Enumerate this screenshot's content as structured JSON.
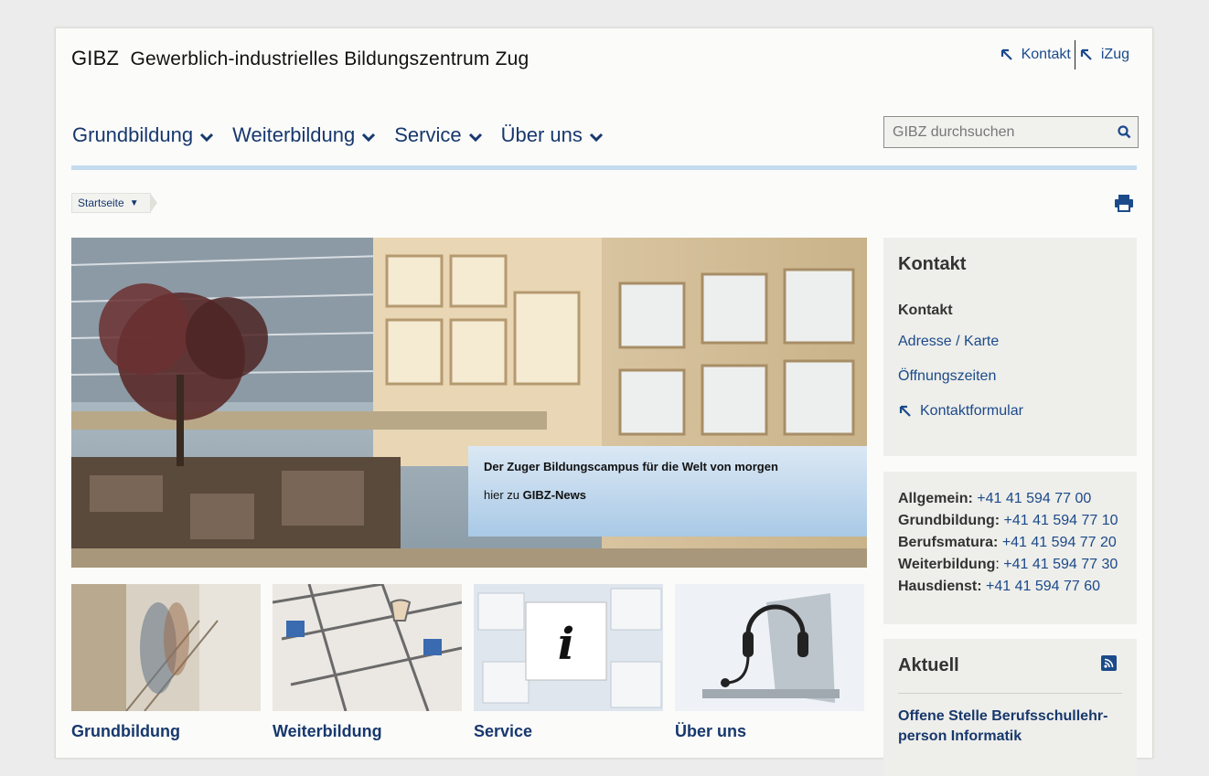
{
  "header": {
    "logo_abbr": "GIBZ",
    "logo_name": "Gewerblich-industrielles Bildungszentrum Zug",
    "top_links": [
      "Kontakt",
      "iZug"
    ]
  },
  "nav": {
    "items": [
      "Grundbildung",
      "Weiterbildung",
      "Service",
      "Über uns"
    ]
  },
  "search": {
    "placeholder": "GIBZ durchsuchen"
  },
  "breadcrumb": {
    "label": "Startseite"
  },
  "hero": {
    "caption_title": "Der Zuger Bildungscampus für die Welt von morgen",
    "caption_prefix": "hier zu ",
    "caption_link": "GIBZ-News"
  },
  "tiles": [
    {
      "label": "Grundbildung"
    },
    {
      "label": "Weiterbildung"
    },
    {
      "label": "Service"
    },
    {
      "label": "Über uns"
    }
  ],
  "sidebar": {
    "contact_title": "Kontakt",
    "contact_subtitle": "Kontakt",
    "contact_links": [
      "Adresse / Karte",
      "Öffnungszeiten",
      "Kontaktformular"
    ],
    "phones": [
      {
        "label": "Allgemein:",
        "value": "+41 41 594 77 00"
      },
      {
        "label": "Grundbildung:",
        "value": "+41 41 594 77 10"
      },
      {
        "label": "Berufsmatura:",
        "value": "+41 41 594 77 20"
      },
      {
        "label": "Weiterbildung",
        "sep": ":",
        "value": "+41 41 594 77 30"
      },
      {
        "label": "Hausdienst:",
        "value": "+41 41 594 77 60"
      }
    ],
    "news_title": "Aktuell",
    "news_item": "Offene Stelle Berufsschullehr-person Informatik"
  },
  "colors": {
    "nav_text": "#17386d",
    "link": "#1b4a8a",
    "nav_line": "#c4dbee",
    "sidebar_bg": "#eeeeea"
  },
  "icons": [
    "arrow-up-left-icon",
    "chevron-down-icon",
    "search-icon",
    "print-icon",
    "rss-icon"
  ]
}
